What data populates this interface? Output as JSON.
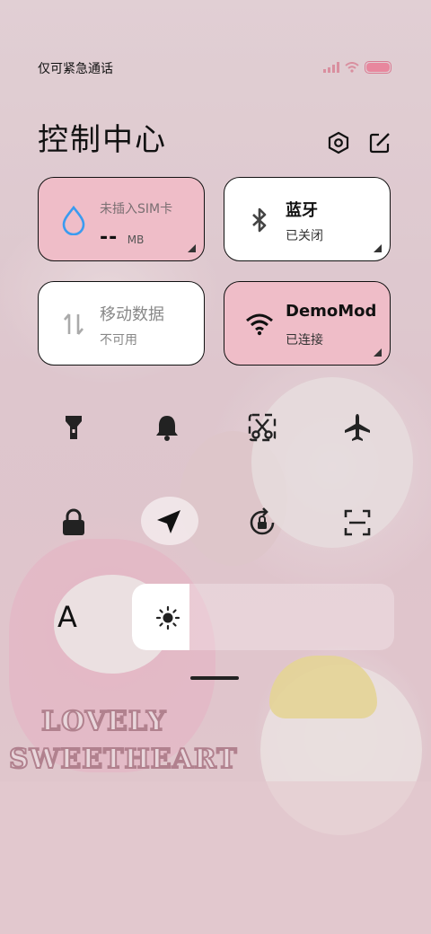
{
  "status": {
    "carrier_text": "仅可紧急通话",
    "battery_level": 1.0,
    "accent": "#e8879e"
  },
  "header": {
    "title": "控制中心",
    "settings_icon": "settings-hexagon-icon",
    "edit_icon": "edit-icon"
  },
  "tiles": [
    {
      "name": "sim",
      "title": "未插入SIM卡",
      "value": "--",
      "unit": "MB",
      "icon": "water-drop-icon",
      "active": true
    },
    {
      "name": "bluetooth",
      "title": "蓝牙",
      "subtitle": "已关闭",
      "icon": "bluetooth-icon",
      "active": false
    },
    {
      "name": "mobile-data",
      "title": "移动数据",
      "subtitle": "不可用",
      "icon": "mobile-data-icon",
      "active": false
    },
    {
      "name": "wifi",
      "title": "DemoMod",
      "subtitle": "已连接",
      "icon": "wifi-icon",
      "active": true
    }
  ],
  "toggles": [
    {
      "name": "flashlight",
      "icon": "flashlight-icon"
    },
    {
      "name": "silent",
      "icon": "bell-icon"
    },
    {
      "name": "screenshot",
      "icon": "scissors-icon"
    },
    {
      "name": "airplane-mode",
      "icon": "airplane-icon"
    },
    {
      "name": "lock-screen",
      "icon": "lock-icon"
    },
    {
      "name": "location",
      "icon": "location-arrow-icon",
      "active": true
    },
    {
      "name": "auto-rotate",
      "icon": "rotation-lock-icon"
    },
    {
      "name": "scanner",
      "icon": "scan-icon"
    }
  ],
  "brightness": {
    "level": 0.22,
    "icon": "sun-icon"
  },
  "font_size_label": "A",
  "wallpaper": {
    "sticker_line1": "LOVELY",
    "sticker_line2": "SWEETHEART"
  }
}
